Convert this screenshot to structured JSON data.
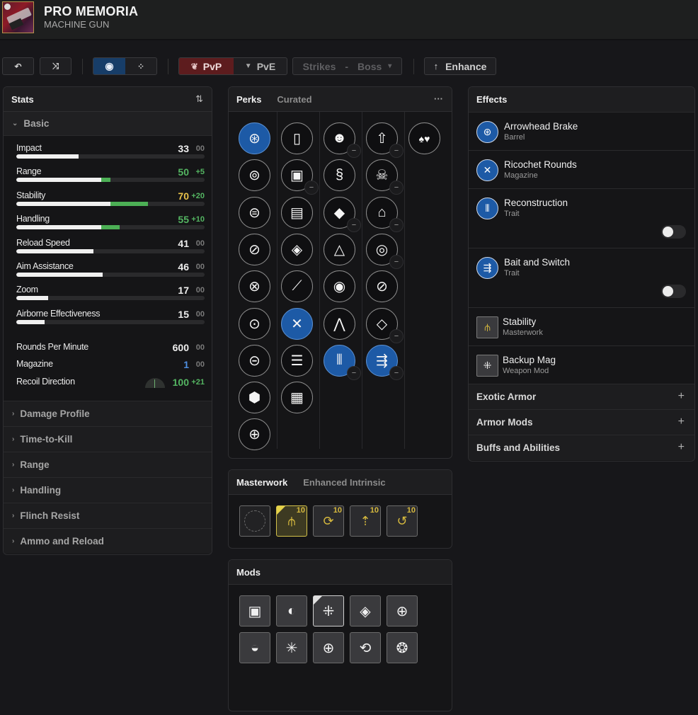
{
  "header": {
    "title": "PRO MEMORIA",
    "subtitle": "MACHINE GUN",
    "weapon_icon": "weapon-thumbnail"
  },
  "toolbar": {
    "undo_icon": "↶",
    "randomize_icon": "⤨",
    "view_single_icon": "◉",
    "view_grid_icon": "⁘",
    "pvp_label": "PvP",
    "pve_label": "PvE",
    "activity_label": "Strikes",
    "activity_separator": "-",
    "activity_target": "Boss",
    "activity_caret": "▾",
    "enhance_label": "Enhance",
    "enhance_icon": "↑",
    "active_mode": "PvP"
  },
  "stats": {
    "title": "Stats",
    "sort_icon": "⇅",
    "basic_label": "Basic",
    "bars": [
      {
        "name": "Impact",
        "value": "33",
        "mod": "00",
        "base": 33,
        "bonus": 0,
        "color": "white"
      },
      {
        "name": "Range",
        "value": "50",
        "mod": "+5",
        "base": 45,
        "bonus": 5,
        "color": "green"
      },
      {
        "name": "Stability",
        "value": "70",
        "mod": "+20",
        "base": 50,
        "bonus": 20,
        "color": "yellow"
      },
      {
        "name": "Handling",
        "value": "55",
        "mod": "+10",
        "base": 45,
        "bonus": 10,
        "color": "green"
      },
      {
        "name": "Reload Speed",
        "value": "41",
        "mod": "00",
        "base": 41,
        "bonus": 0,
        "color": "white"
      },
      {
        "name": "Aim Assistance",
        "value": "46",
        "mod": "00",
        "base": 46,
        "bonus": 0,
        "color": "white"
      },
      {
        "name": "Zoom",
        "value": "17",
        "mod": "00",
        "base": 17,
        "bonus": 0,
        "color": "white"
      },
      {
        "name": "Airborne Effectiveness",
        "value": "15",
        "mod": "00",
        "base": 15,
        "bonus": 0,
        "color": "white"
      }
    ],
    "plain": [
      {
        "name": "Rounds Per Minute",
        "value": "600",
        "mod": "00",
        "color": "white"
      },
      {
        "name": "Magazine",
        "value": "1",
        "mod": "00",
        "color": "blue"
      },
      {
        "name": "Recoil Direction",
        "value": "100",
        "mod": "+21",
        "color": "green"
      }
    ],
    "sections": [
      "Damage Profile",
      "Time-to-Kill",
      "Range",
      "Handling",
      "Flinch Resist",
      "Ammo and Reload"
    ]
  },
  "perks": {
    "tab_active": "Perks",
    "tab_inactive": "Curated",
    "more_icon": "···",
    "columns": [
      [
        {
          "icon": "arrowhead-brake-icon",
          "glyph": "⊛",
          "selected": true
        },
        {
          "icon": "barrel-icon",
          "glyph": "⊚",
          "selected": false
        },
        {
          "icon": "barrel-icon",
          "glyph": "⊜",
          "selected": false
        },
        {
          "icon": "barrel-icon",
          "glyph": "⊘",
          "selected": false
        },
        {
          "icon": "barrel-icon",
          "glyph": "⊗",
          "selected": false
        },
        {
          "icon": "barrel-icon",
          "glyph": "⊙",
          "selected": false
        },
        {
          "icon": "barrel-icon",
          "glyph": "⊝",
          "selected": false
        },
        {
          "icon": "barrel-icon",
          "glyph": "⬢",
          "selected": false
        },
        {
          "icon": "barrel-icon",
          "glyph": "⊕",
          "selected": false
        }
      ],
      [
        {
          "icon": "magazine-icon",
          "glyph": "▯",
          "selected": false
        },
        {
          "icon": "magazine-icon",
          "glyph": "▣",
          "selected": false,
          "minus": true
        },
        {
          "icon": "magazine-icon",
          "glyph": "▤",
          "selected": false
        },
        {
          "icon": "magazine-icon",
          "glyph": "◈",
          "selected": false
        },
        {
          "icon": "magazine-icon",
          "glyph": "⟋",
          "selected": false
        },
        {
          "icon": "ricochet-rounds-icon",
          "glyph": "✕",
          "selected": true
        },
        {
          "icon": "magazine-icon",
          "glyph": "☰",
          "selected": false
        },
        {
          "icon": "magazine-icon",
          "glyph": "▦",
          "selected": false
        }
      ],
      [
        {
          "icon": "trait-icon",
          "glyph": "☻",
          "selected": false,
          "minus": true
        },
        {
          "icon": "trait-icon",
          "glyph": "§",
          "selected": false
        },
        {
          "icon": "trait-icon",
          "glyph": "◆",
          "selected": false,
          "minus": true
        },
        {
          "icon": "trait-icon",
          "glyph": "△",
          "selected": false
        },
        {
          "icon": "trait-icon",
          "glyph": "◉",
          "selected": false
        },
        {
          "icon": "trait-icon",
          "glyph": "⋀",
          "selected": false
        },
        {
          "icon": "reconstruction-icon",
          "glyph": "⫴",
          "selected": true,
          "minus": true
        }
      ],
      [
        {
          "icon": "trait-icon",
          "glyph": "⇧",
          "selected": false,
          "minus": true
        },
        {
          "icon": "trait-icon",
          "glyph": "☠",
          "selected": false,
          "minus": true
        },
        {
          "icon": "trait-icon",
          "glyph": "⌂",
          "selected": false,
          "minus": true
        },
        {
          "icon": "trait-icon",
          "glyph": "◎",
          "selected": false,
          "minus": true
        },
        {
          "icon": "trait-icon",
          "glyph": "⊘",
          "selected": false
        },
        {
          "icon": "trait-icon",
          "glyph": "◇",
          "selected": false,
          "minus": true
        },
        {
          "icon": "bait-and-switch-icon",
          "glyph": "⇶",
          "selected": true,
          "minus": true
        }
      ],
      [
        {
          "icon": "origin-trait-icon",
          "glyph": "♠♥",
          "selected": false
        }
      ]
    ]
  },
  "masterwork": {
    "tab_active": "Masterwork",
    "tab_inactive": "Enhanced Intrinsic",
    "items": [
      {
        "icon": "empty-slot-icon",
        "level": "",
        "empty": true,
        "selected": false
      },
      {
        "icon": "stability-mw-icon",
        "glyph": "⫛",
        "level": "10",
        "selected": true
      },
      {
        "icon": "reload-mw-icon",
        "glyph": "⟳",
        "level": "10",
        "selected": false
      },
      {
        "icon": "handling-mw-icon",
        "glyph": "⇡",
        "level": "10",
        "selected": false
      },
      {
        "icon": "range-mw-icon",
        "glyph": "↺",
        "level": "10",
        "selected": false
      }
    ]
  },
  "mods": {
    "title": "Mods",
    "items": [
      {
        "icon": "empty-mod-icon",
        "glyph": "▣",
        "selected": false
      },
      {
        "icon": "counterbalance-icon",
        "glyph": "◐",
        "selected": false
      },
      {
        "icon": "backup-mag-icon",
        "glyph": "⁜",
        "selected": true
      },
      {
        "icon": "icarus-grip-icon",
        "glyph": "◈",
        "selected": false
      },
      {
        "icon": "targeting-icon",
        "glyph": "⊕",
        "selected": false
      },
      {
        "icon": "freehand-grip-icon",
        "glyph": "◒",
        "selected": false
      },
      {
        "icon": "minor-spec-icon",
        "glyph": "✳",
        "selected": false
      },
      {
        "icon": "major-spec-icon",
        "glyph": "⊕",
        "selected": false
      },
      {
        "icon": "quick-access-sling-icon",
        "glyph": "⟲",
        "selected": false
      },
      {
        "icon": "boss-spec-icon",
        "glyph": "❂",
        "selected": false
      }
    ]
  },
  "effects": {
    "title": "Effects",
    "items": [
      {
        "name": "Arrowhead Brake",
        "type": "Barrel",
        "icon": "arrowhead-brake-icon",
        "glyph": "⊛",
        "toggle": false
      },
      {
        "name": "Ricochet Rounds",
        "type": "Magazine",
        "icon": "ricochet-rounds-icon",
        "glyph": "✕",
        "toggle": false
      },
      {
        "name": "Reconstruction",
        "type": "Trait",
        "icon": "reconstruction-icon",
        "glyph": "⫴",
        "toggle": true,
        "toggle_on": false
      },
      {
        "name": "Bait and Switch",
        "type": "Trait",
        "icon": "bait-and-switch-icon",
        "glyph": "⇶",
        "toggle": true,
        "toggle_on": false
      },
      {
        "name": "Stability",
        "type": "Masterwork",
        "icon": "stability-mw-icon",
        "glyph": "⫛",
        "square": true,
        "toggle": false
      },
      {
        "name": "Backup Mag",
        "type": "Weapon Mod",
        "icon": "backup-mag-icon",
        "glyph": "⁜",
        "square": true,
        "toggle": false
      }
    ],
    "sections": [
      "Exotic Armor",
      "Armor Mods",
      "Buffs and Abilities"
    ],
    "plus_icon": "+"
  },
  "colors": {
    "selected_perk": "#1d5aa6",
    "pvp_active": "#5d1c1e",
    "view_active": "#173d68",
    "stat_green": "#54b562",
    "stat_yellow": "#e8c14a",
    "stat_blue": "#4e8ee0",
    "masterwork_gold": "#d6b93e"
  }
}
